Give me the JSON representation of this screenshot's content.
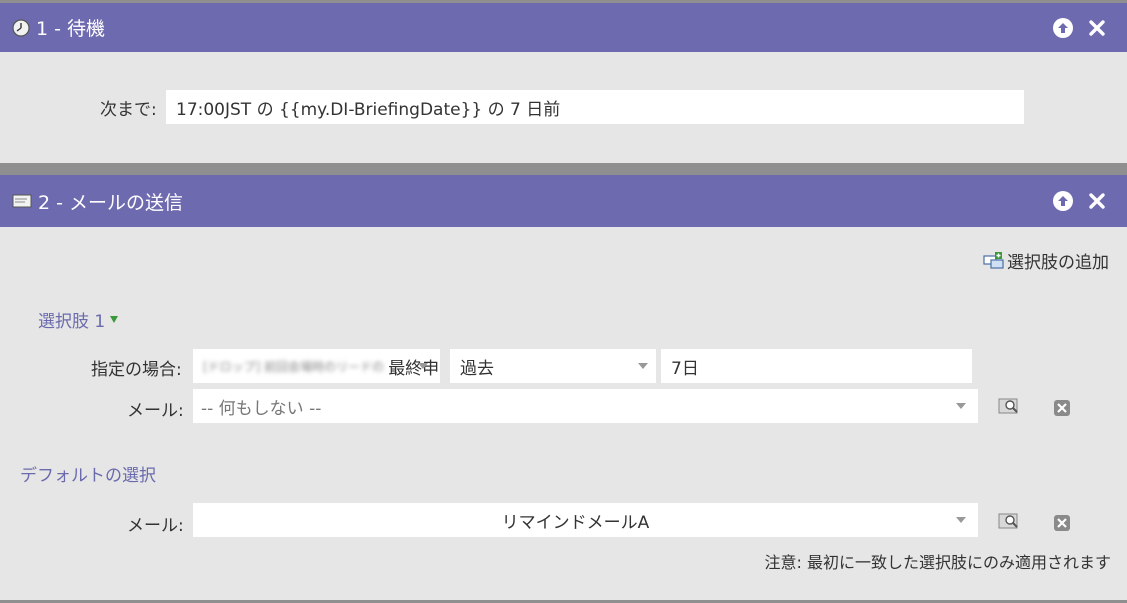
{
  "step1": {
    "title": "1 - 待機",
    "icon": "clock-icon",
    "wait_label": "次まで:",
    "wait_value": "17:00JST の {{my.DI-BriefingDate}} の 7 日前"
  },
  "step2": {
    "title": "2 - メールの送信",
    "icon": "email-icon",
    "add_choice_label": "選択肢の追加",
    "choice1": {
      "label": "選択肢 1",
      "condition_label": "指定の場合:",
      "field_blurred": "[ドロップ] 前回会場時のリードの",
      "field_value": "最終申込",
      "operator": "過去",
      "value": "7日",
      "email_label": "メール:",
      "email_value": "-- 何もしない --"
    },
    "default": {
      "label": "デフォルトの選択",
      "email_label": "メール:",
      "email_value": "リマインドメールA"
    },
    "note": "注意: 最初に一致した選択肢にのみ適用されます"
  },
  "colors": {
    "header": "#6e6aaf",
    "panel_bg": "#e6e6e6",
    "section_label": "#6a6aad",
    "separator": "#8f8f8f"
  }
}
